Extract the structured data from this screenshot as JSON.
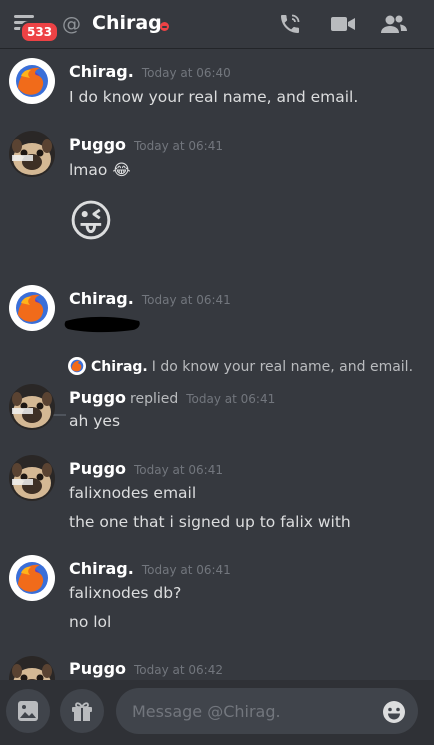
{
  "header": {
    "badge_count": "533",
    "at_symbol": "@",
    "title": "Chirag.",
    "icons": [
      "menu-icon",
      "at-icon",
      "call-icon",
      "video-icon",
      "members-icon"
    ]
  },
  "messages": [
    {
      "author": "Chirag.",
      "time": "Today at 06:40",
      "lines": [
        "I do know your real name, and email."
      ],
      "avatar": "firefox-avatar"
    },
    {
      "author": "Puggo",
      "time": "Today at 06:41",
      "lines": [
        "lmao 😂"
      ],
      "avatar": "pug-avatar",
      "emoji": "😜"
    },
    {
      "author": "Chirag.",
      "time": "Today at 06:41",
      "lines": [],
      "avatar": "firefox-avatar",
      "redacted": true
    },
    {
      "author": "Puggo",
      "replied_label": "replied",
      "time": "Today at 06:41",
      "lines": [
        "ah yes"
      ],
      "avatar": "pug-avatar",
      "reply_to": {
        "author": "Chirag.",
        "text": "I do know your real name, and email."
      }
    },
    {
      "author": "Puggo",
      "time": "Today at 06:41",
      "lines": [
        "falixnodes email",
        "the one that i signed up to falix with"
      ],
      "avatar": "pug-avatar"
    },
    {
      "author": "Chirag.",
      "time": "Today at 06:41",
      "lines": [
        "falixnodes db?",
        "no lol"
      ],
      "avatar": "firefox-avatar"
    },
    {
      "author": "Puggo",
      "time": "Today at 06:42",
      "lines": [],
      "avatar": "pug-avatar"
    }
  ],
  "composer": {
    "placeholder": "Message @Chirag.",
    "icons": [
      "image-icon",
      "gift-icon",
      "emoji-icon"
    ]
  },
  "colors": {
    "background": "#36393f",
    "composer_bar": "#2f3136",
    "badge": "#ed4245",
    "timestamp": "#72767d"
  }
}
